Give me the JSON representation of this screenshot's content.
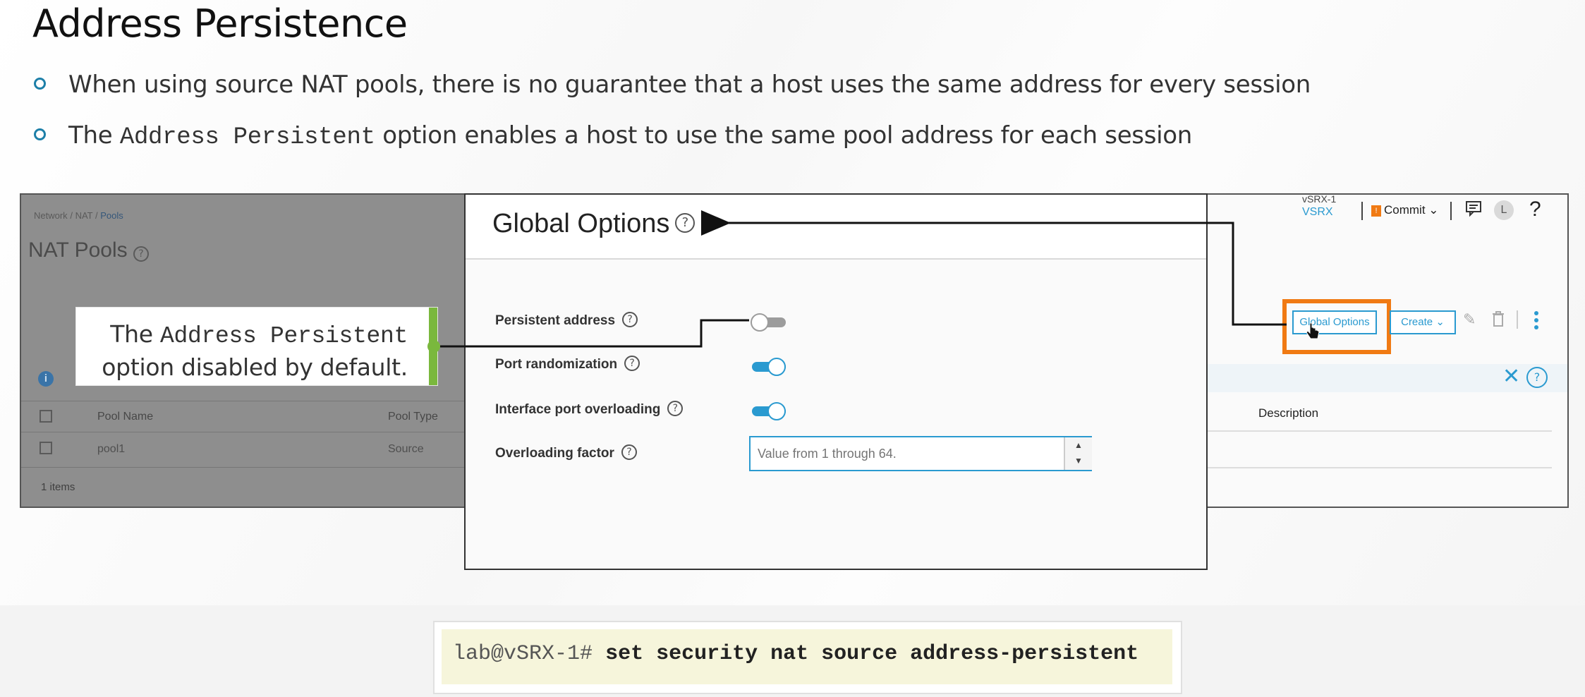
{
  "slide": {
    "title": "Address Persistence",
    "bullet1": "When using source NAT pools, there is no guarantee that a host uses the same address for every session",
    "bullet2_pre": "The ",
    "bullet2_mono": "Address Persistent",
    "bullet2_post": " option enables a host to use the same pool address for each session"
  },
  "app": {
    "breadcrumb": [
      "Network",
      "NAT",
      "Pools"
    ],
    "breadcrumb_sep": "/",
    "page_title": "NAT Pools",
    "help_glyph": "?",
    "info_glyph": "i",
    "columns": [
      "Pool Name",
      "Pool Type",
      "Description"
    ],
    "rows": [
      {
        "pool_name": "pool1",
        "pool_type": "Source"
      }
    ],
    "item_count": "1 items",
    "device_name_top": "vSRX-1",
    "device_name_bottom": "VSRX",
    "commit_label": "Commit",
    "commit_badge": "!",
    "avatar_letter": "L",
    "global_options_label": "Global Options",
    "create_label": "Create",
    "close_glyph": "✕"
  },
  "modal": {
    "title": "Global Options",
    "persistent_address_label": "Persistent address",
    "persistent_address_on": false,
    "port_randomization_label": "Port randomization",
    "port_randomization_on": true,
    "interface_port_overloading_label": "Interface port overloading",
    "interface_port_overloading_on": true,
    "overloading_factor_label": "Overloading factor",
    "overloading_factor_placeholder": "Value from 1 through 64.",
    "overloading_factor_value": ""
  },
  "callout": {
    "line1_pre": "The ",
    "line1_mono": "Address Persistent",
    "line2": "option disabled by default."
  },
  "code": {
    "prompt": "lab@vSRX-1#",
    "command": "set security nat source address-persistent"
  },
  "colors": {
    "accent_blue": "#2a9ad0",
    "highlight_orange": "#f07a13",
    "callout_green": "#7ab83d",
    "bullet_teal": "#1d7fa8"
  }
}
